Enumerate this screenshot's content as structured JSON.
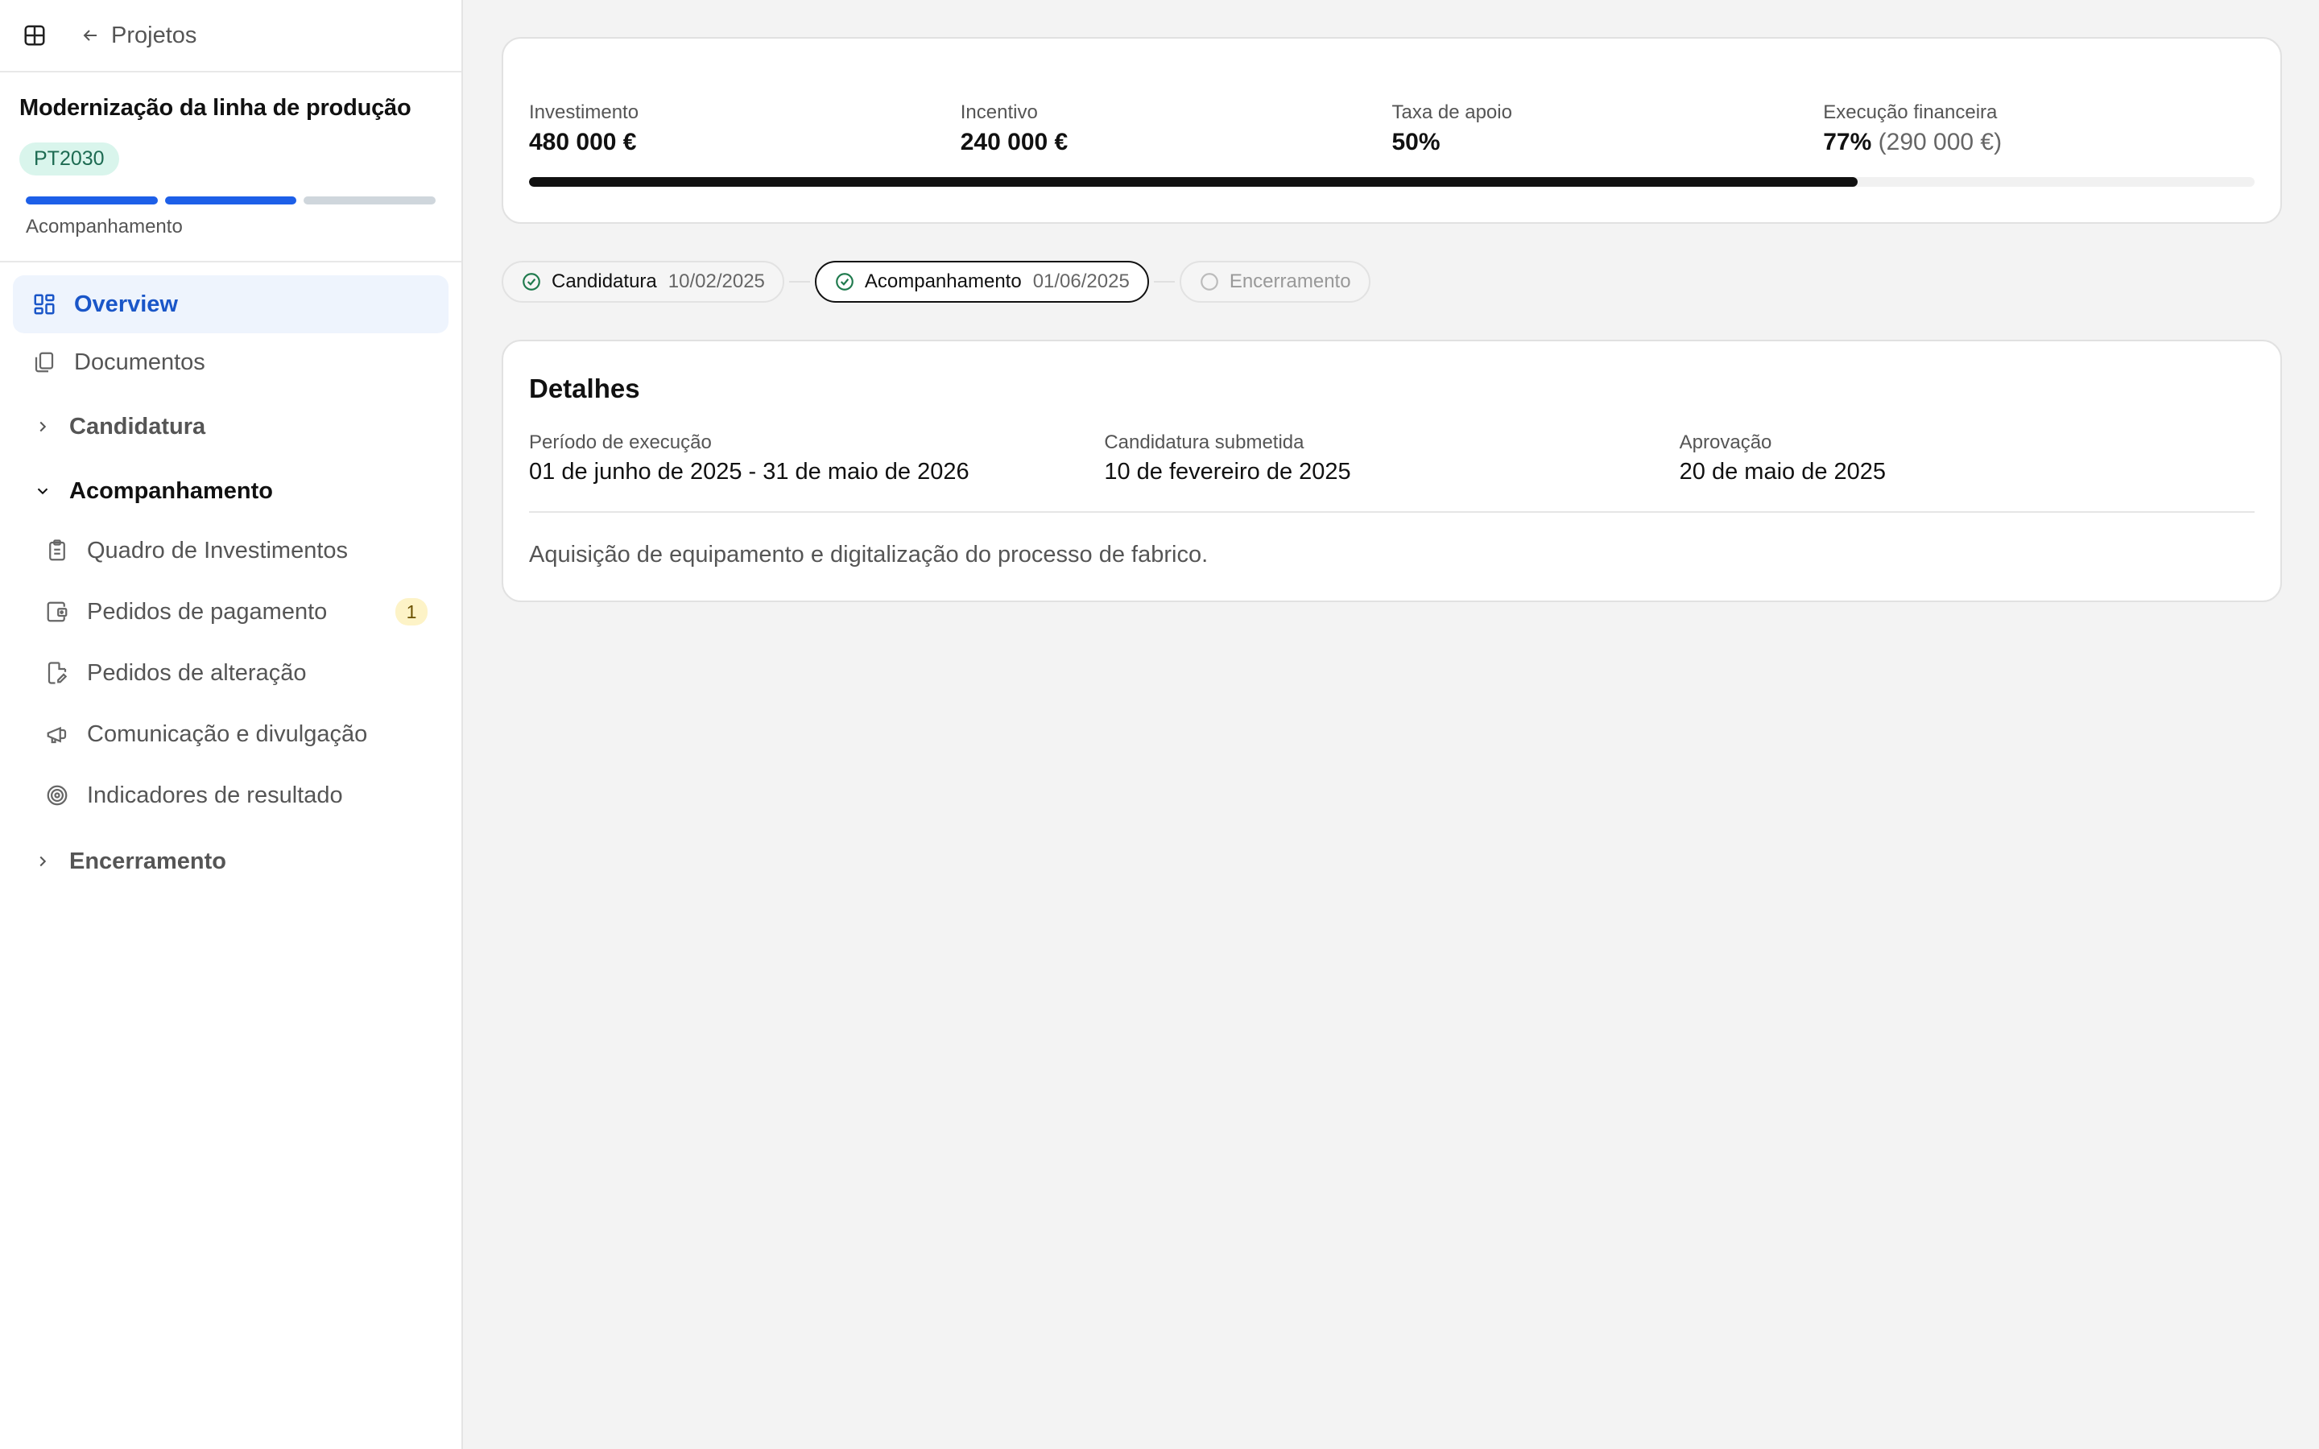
{
  "sidebar": {
    "back_label": "Projetos",
    "project_title": "Modernização da linha de produção",
    "program_badge": "PT2030",
    "phase_progress": {
      "completed": 2,
      "total": 3
    },
    "current_phase": "Acompanhamento",
    "nav": {
      "overview": "Overview",
      "documents": "Documentos",
      "group_candidatura": "Candidatura",
      "group_acompanhamento": "Acompanhamento",
      "sub": [
        {
          "label": "Quadro de Investimentos",
          "icon": "clipboard-icon"
        },
        {
          "label": "Pedidos de pagamento",
          "icon": "wallet-icon",
          "count": "1"
        },
        {
          "label": "Pedidos de alteração",
          "icon": "file-edit-icon"
        },
        {
          "label": "Comunicação e divulgação",
          "icon": "megaphone-icon"
        },
        {
          "label": "Indicadores de resultado",
          "icon": "target-icon"
        }
      ],
      "group_encerramento": "Encerramento"
    }
  },
  "stats": {
    "investment_label": "Investimento",
    "investment_value": "480 000 €",
    "incentive_label": "Incentivo",
    "incentive_value": "240 000 €",
    "rate_label": "Taxa de apoio",
    "rate_value": "50%",
    "execution_label": "Execução financeira",
    "execution_percent": "77%",
    "execution_amount": "(290 000 €)",
    "execution_fraction": 0.77
  },
  "steps": [
    {
      "label": "Candidatura",
      "date": "10/02/2025",
      "state": "done"
    },
    {
      "label": "Acompanhamento",
      "date": "01/06/2025",
      "state": "current"
    },
    {
      "label": "Encerramento",
      "state": "pending"
    }
  ],
  "details": {
    "title": "Detalhes",
    "period_label": "Período de execução",
    "period_value": "01 de junho de 2025 - 31 de maio de 2026",
    "submitted_label": "Candidatura submetida",
    "submitted_value": "10 de fevereiro de 2025",
    "approval_label": "Aprovação",
    "approval_value": "20 de maio de 2025",
    "description": "Aquisição de equipamento e digitalização do processo de fabrico."
  },
  "colors": {
    "accent": "#1d5fe8",
    "badge_bg": "#d9f5ec",
    "success": "#1f7a4d",
    "count_badge_bg": "#fdf3c7"
  }
}
